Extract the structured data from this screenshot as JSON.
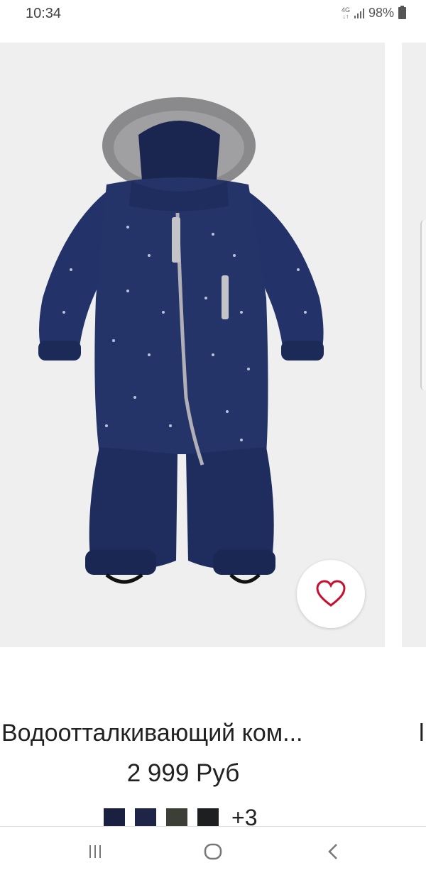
{
  "status_bar": {
    "time": "10:34",
    "network": "4G",
    "battery": "98%"
  },
  "product": {
    "title": "Водоотталкивающий ком...",
    "price": "2 999 Руб",
    "swatches": [
      {
        "name": "navy",
        "color": "#1a2040"
      },
      {
        "name": "dark-navy",
        "color": "#1f2547"
      },
      {
        "name": "olive",
        "color": "#3b3f36"
      },
      {
        "name": "black",
        "color": "#1e1f21"
      }
    ],
    "more_colors": "+3"
  },
  "next_product": {
    "title_fragment": "l"
  },
  "colors": {
    "navy": "#1f2d5a",
    "background": "#efefef",
    "accent_heart": "#c8102e"
  },
  "icons": {
    "favorite": "heart-icon",
    "recents": "recents-icon",
    "home": "home-icon",
    "back": "back-icon"
  }
}
